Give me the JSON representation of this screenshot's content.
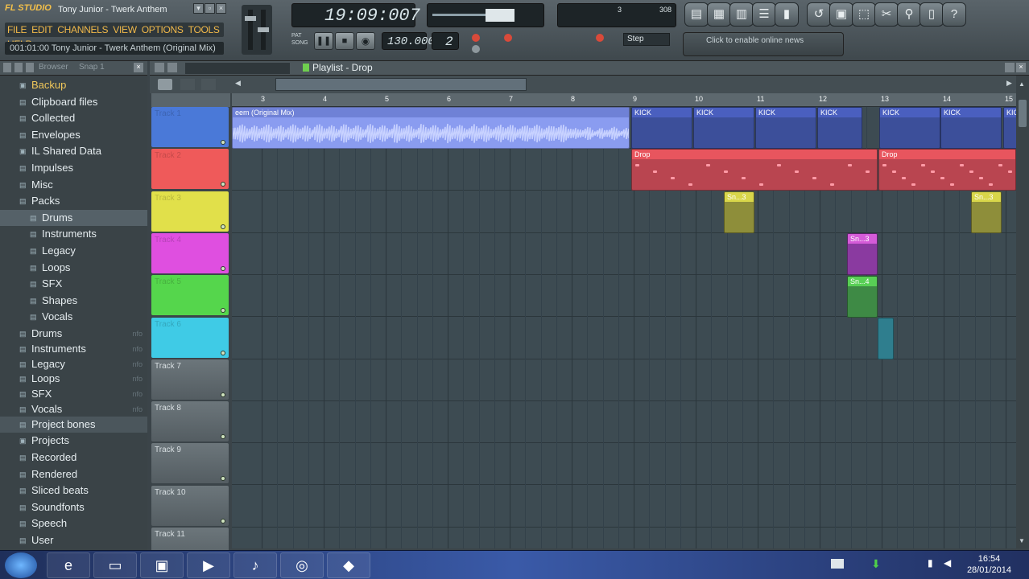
{
  "app": {
    "logo": "FL STUDIO",
    "song_title": "Tony Junior - Twerk Anthem",
    "menu": [
      "FILE",
      "EDIT",
      "CHANNELS",
      "VIEW",
      "OPTIONS",
      "TOOLS",
      "HELP"
    ],
    "hint_text": "001:01:00 Tony Junior - Twerk Anthem (Original Mix)",
    "time_display": "19:09:007",
    "tempo": "130.000",
    "pattern_number": "2",
    "snap_label": "Step",
    "news_text": "Click to enable online news",
    "cpu_value": "3",
    "poly_value": "308"
  },
  "browser": {
    "header_label": "Browser",
    "snap_label": "Snap 1",
    "items": [
      {
        "label": "Backup",
        "level": 0,
        "icon": "folder-open",
        "accent": true
      },
      {
        "label": "Clipboard files",
        "level": 0,
        "icon": "folder"
      },
      {
        "label": "Collected",
        "level": 0,
        "icon": "folder"
      },
      {
        "label": "Envelopes",
        "level": 0,
        "icon": "folder"
      },
      {
        "label": "IL Shared Data",
        "level": 0,
        "icon": "folder-open"
      },
      {
        "label": "Impulses",
        "level": 0,
        "icon": "folder"
      },
      {
        "label": "Misc",
        "level": 0,
        "icon": "folder"
      },
      {
        "label": "Packs",
        "level": 0,
        "icon": "folder"
      },
      {
        "label": "Drums",
        "level": 1,
        "icon": "folder",
        "selected": true
      },
      {
        "label": "Instruments",
        "level": 1,
        "icon": "folder"
      },
      {
        "label": "Legacy",
        "level": 1,
        "icon": "folder"
      },
      {
        "label": "Loops",
        "level": 1,
        "icon": "folder"
      },
      {
        "label": "SFX",
        "level": 1,
        "icon": "folder"
      },
      {
        "label": "Shapes",
        "level": 1,
        "icon": "folder"
      },
      {
        "label": "Vocals",
        "level": 1,
        "icon": "folder"
      },
      {
        "label": "Drums",
        "level": 0,
        "icon": "folder",
        "tag": "nfo"
      },
      {
        "label": "Instruments",
        "level": 0,
        "icon": "folder",
        "tag": "nfo"
      },
      {
        "label": "Legacy",
        "level": 0,
        "icon": "folder",
        "tag": "nfo"
      },
      {
        "label": "Loops",
        "level": 0,
        "icon": "folder",
        "tag": "nfo"
      },
      {
        "label": "SFX",
        "level": 0,
        "icon": "folder",
        "tag": "nfo"
      },
      {
        "label": "Vocals",
        "level": 0,
        "icon": "folder",
        "tag": "nfo"
      },
      {
        "label": "Project bones",
        "level": 0,
        "icon": "folder",
        "highlight": true
      },
      {
        "label": "Projects",
        "level": 0,
        "icon": "folder-open"
      },
      {
        "label": "Recorded",
        "level": 0,
        "icon": "folder"
      },
      {
        "label": "Rendered",
        "level": 0,
        "icon": "folder"
      },
      {
        "label": "Sliced beats",
        "level": 0,
        "icon": "folder"
      },
      {
        "label": "Soundfonts",
        "level": 0,
        "icon": "folder"
      },
      {
        "label": "Speech",
        "level": 0,
        "icon": "folder"
      },
      {
        "label": "User",
        "level": 0,
        "icon": "folder"
      }
    ]
  },
  "playlist": {
    "title": "Playlist - Drop",
    "ruler_bars": [
      "3",
      "4",
      "5",
      "6",
      "7",
      "8",
      "9",
      "10",
      "11",
      "12",
      "13",
      "14",
      "15"
    ],
    "tracks": [
      {
        "name": "Track 1",
        "color": "#4a79d8"
      },
      {
        "name": "Track 2",
        "color": "#ef5a5a"
      },
      {
        "name": "Track 3",
        "color": "#e1e04a"
      },
      {
        "name": "Track 4",
        "color": "#df4fe0"
      },
      {
        "name": "Track 5",
        "color": "#55d64c"
      },
      {
        "name": "Track 6",
        "color": "#3fcbe6"
      },
      {
        "name": "Track 7",
        "color": "#7c868b"
      },
      {
        "name": "Track 8",
        "color": "#7c868b"
      },
      {
        "name": "Track 9",
        "color": "#7c868b"
      },
      {
        "name": "Track 10",
        "color": "#7c868b"
      },
      {
        "name": "Track 11",
        "color": "#7c868b"
      }
    ],
    "clips": {
      "audio_label": "eem (Original Mix)",
      "kick_label": "KICK",
      "drop_label": "Drop",
      "short_clip_label": "Sn...3",
      "short_clip_label2": "Sn...4"
    }
  },
  "taskbar": {
    "time": "16:54",
    "date": "28/01/2014"
  },
  "colors": {
    "accent_orange": "#f0b84a",
    "grid_bg": "#3d4b52",
    "audio_clip": "#8a9cf0",
    "kick_clip": "#3c4f9a",
    "drop_clip": "#b94550"
  }
}
